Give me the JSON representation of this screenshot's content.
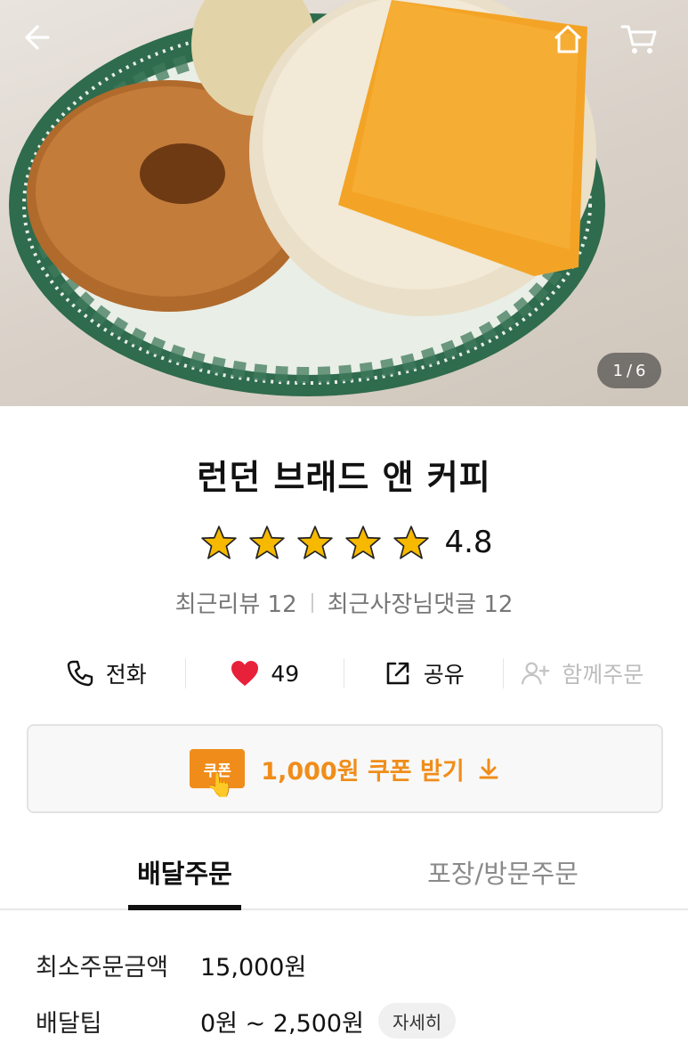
{
  "gallery": {
    "current": "1",
    "sep": "/",
    "total": "6"
  },
  "store": {
    "name": "런던 브래드 앤 커피",
    "rating": "4.8",
    "stars": 5
  },
  "reviews": {
    "recent_reviews": "최근리뷰 12",
    "owner_replies": "최근사장님댓글 12"
  },
  "actions": {
    "call": "전화",
    "likes": "49",
    "share": "공유",
    "group_order": "함께주문"
  },
  "coupon": {
    "badge": "쿠폰",
    "label": "1,000원 쿠폰 받기"
  },
  "tabs": {
    "delivery": "배달주문",
    "pickup": "포장/방문주문"
  },
  "info": {
    "min_order_label": "최소주문금액",
    "min_order_value": "15,000원",
    "tip_label": "배달팁",
    "tip_value": "0원 ~ 2,500원",
    "detail_button": "자세히"
  },
  "colors": {
    "accent": "#f08d1a",
    "heart": "#e8213b",
    "star": "#f6b900"
  },
  "icons": [
    "back-arrow-icon",
    "home-icon",
    "cart-icon",
    "phone-icon",
    "heart-icon",
    "share-icon",
    "add-person-icon",
    "download-arrow-icon",
    "star-icon",
    "hand-icon"
  ]
}
